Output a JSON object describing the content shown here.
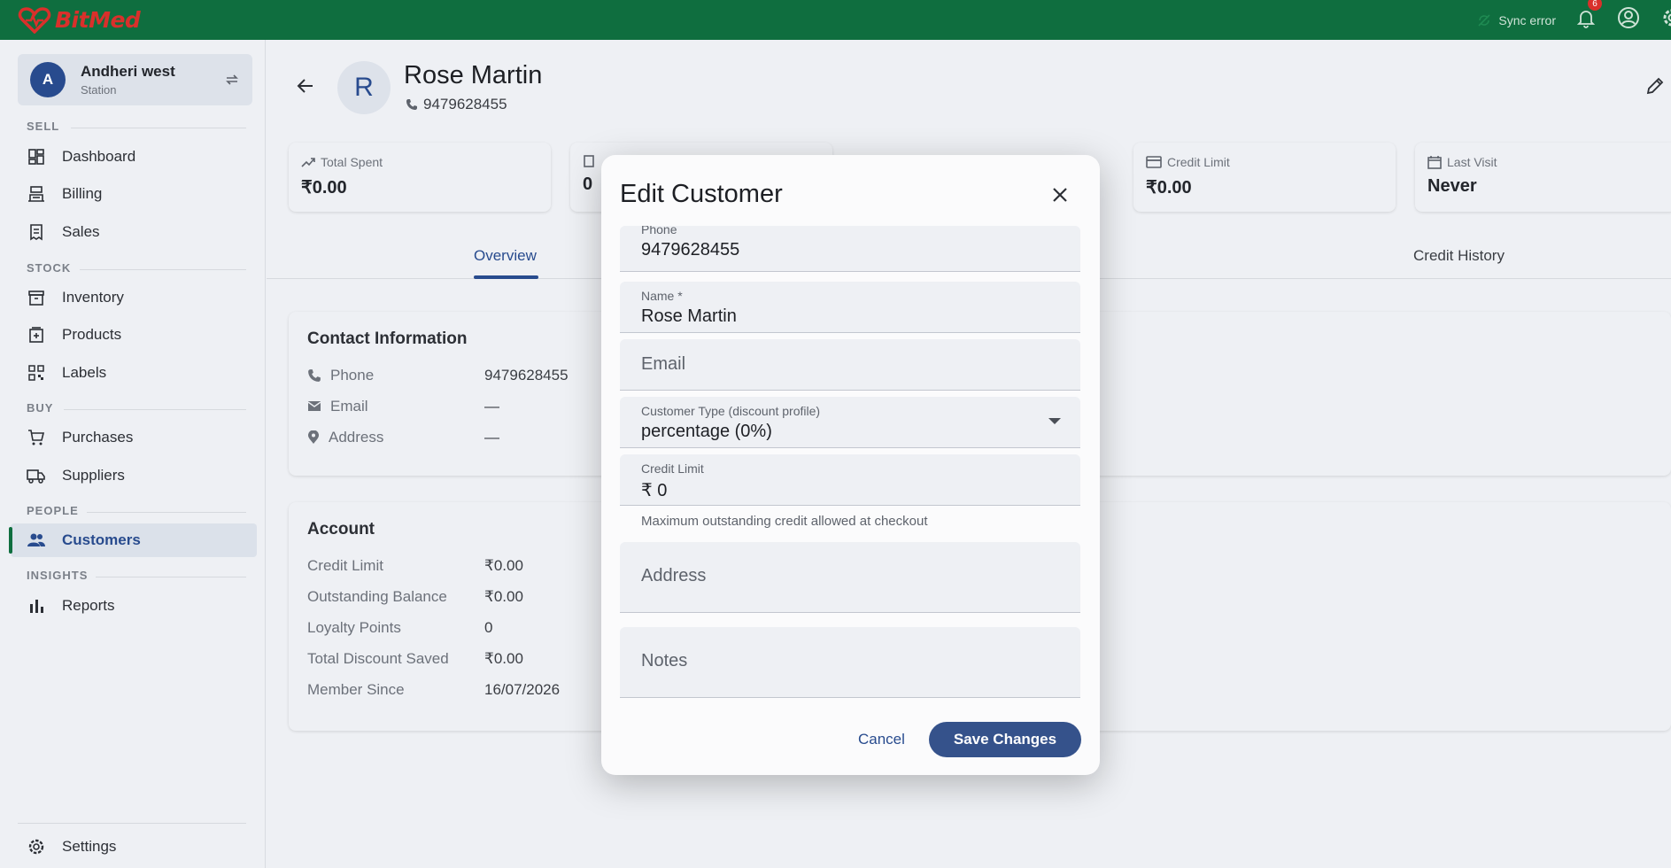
{
  "app": {
    "logo_text": "BitMed",
    "sync_status": "Sync error",
    "notification_count": "6"
  },
  "colors": {
    "topbar": "#0f6e3f",
    "accent": "#284b8e",
    "primary_button": "#35528b",
    "logo": "#d9302b"
  },
  "station": {
    "avatar_letter": "A",
    "name": "Andheri west",
    "type": "Station"
  },
  "sidebar": {
    "sections": {
      "sell": "SELL",
      "stock": "STOCK",
      "buy": "BUY",
      "people": "PEOPLE",
      "insights": "INSIGHTS"
    },
    "items": {
      "dashboard": "Dashboard",
      "billing": "Billing",
      "sales": "Sales",
      "inventory": "Inventory",
      "products": "Products",
      "labels": "Labels",
      "purchases": "Purchases",
      "suppliers": "Suppliers",
      "customers": "Customers",
      "reports": "Reports",
      "settings": "Settings"
    },
    "active_item": "Customers"
  },
  "customer": {
    "avatar_letter": "R",
    "name": "Rose Martin",
    "phone": "9479628455"
  },
  "stats": [
    {
      "label": "Total Spent",
      "value": "₹0.00"
    },
    {
      "label": "",
      "value": "0"
    },
    {
      "label": "Credit Limit",
      "value": "₹0.00"
    },
    {
      "label": "Last Visit",
      "value": "Never"
    }
  ],
  "tabs": {
    "overview": "Overview",
    "credit_history": "Credit History"
  },
  "contact": {
    "title": "Contact Information",
    "rows": [
      {
        "label": "Phone",
        "value": "9479628455"
      },
      {
        "label": "Email",
        "value": "—"
      },
      {
        "label": "Address",
        "value": "—"
      }
    ]
  },
  "account": {
    "title": "Account",
    "rows": [
      {
        "label": "Credit Limit",
        "value": "₹0.00"
      },
      {
        "label": "Outstanding Balance",
        "value": "₹0.00"
      },
      {
        "label": "Loyalty Points",
        "value": "0"
      },
      {
        "label": "Total Discount Saved",
        "value": "₹0.00"
      },
      {
        "label": "Member Since",
        "value": "16/07/2026"
      }
    ]
  },
  "dialog": {
    "title": "Edit Customer",
    "phone": {
      "label": "Phone",
      "value": "9479628455"
    },
    "name": {
      "label": "Name *",
      "value": "Rose Martin"
    },
    "email": {
      "placeholder": "Email"
    },
    "customer_type": {
      "label": "Customer Type (discount profile)",
      "value": "percentage (0%)"
    },
    "credit_limit": {
      "label": "Credit Limit",
      "value": "₹ 0",
      "helper": "Maximum outstanding credit allowed at checkout"
    },
    "address": {
      "placeholder": "Address"
    },
    "notes": {
      "placeholder": "Notes"
    },
    "cancel_label": "Cancel",
    "save_label": "Save Changes"
  }
}
